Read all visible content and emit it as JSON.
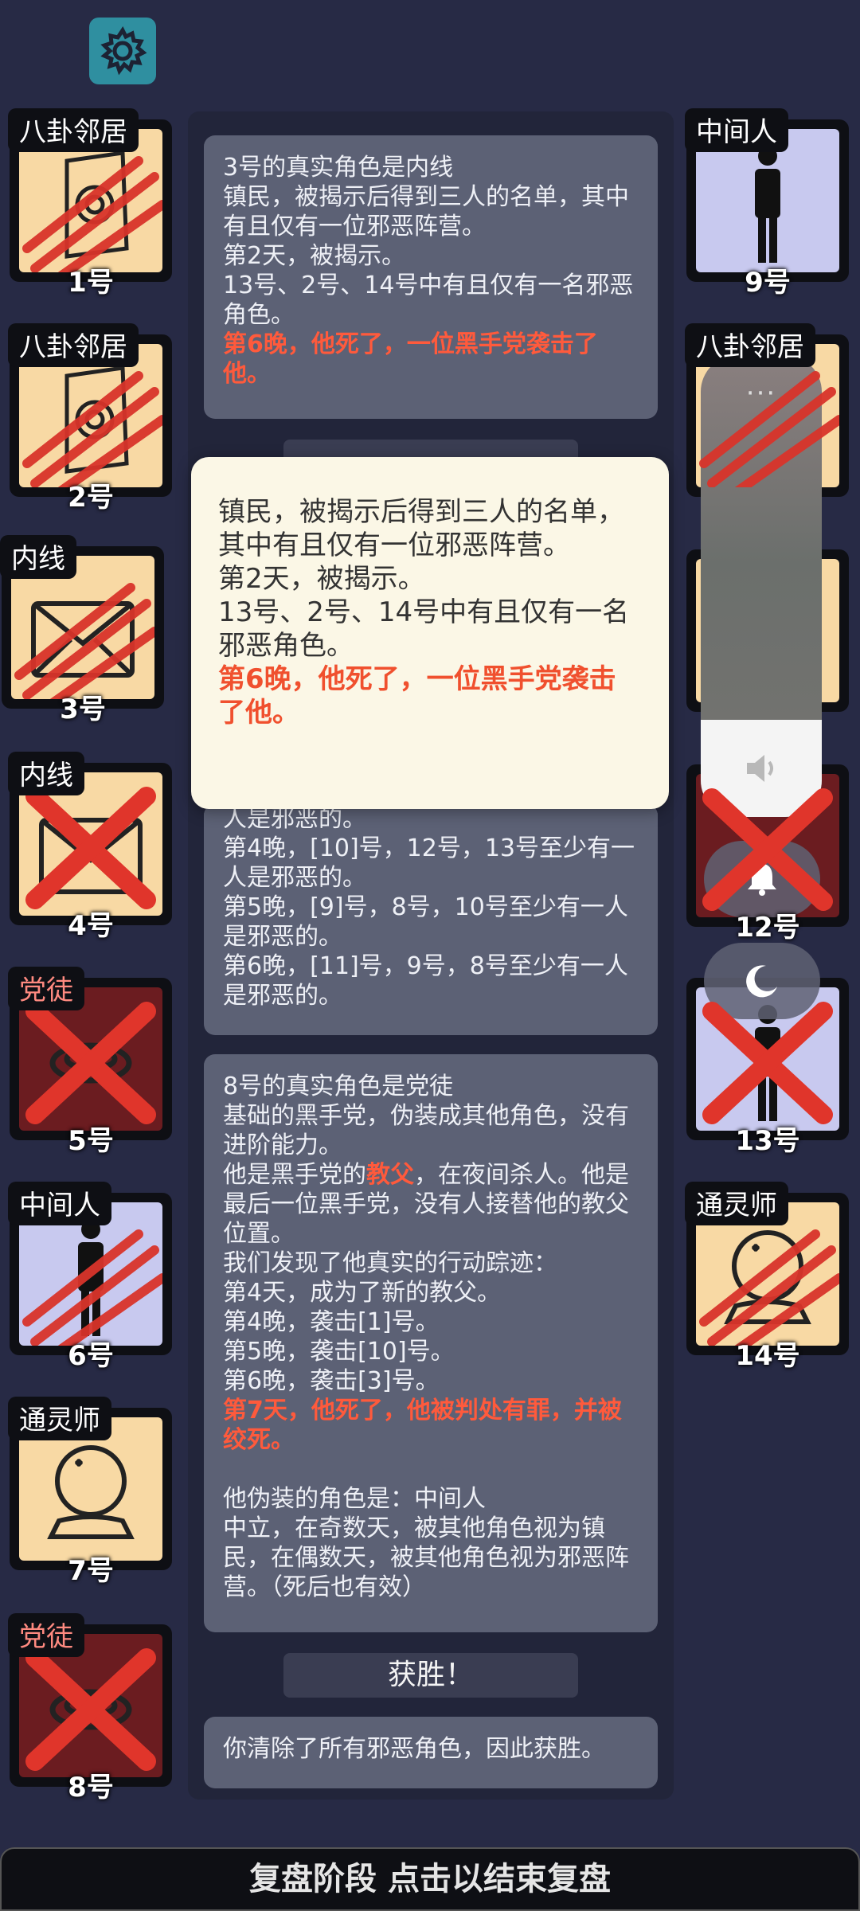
{
  "settings": {
    "icon": "gear-icon"
  },
  "players_left": [
    {
      "role": "八卦邻居",
      "num": "1号",
      "type": "town",
      "art": "gossip",
      "mark": "claw"
    },
    {
      "role": "八卦邻居",
      "num": "2号",
      "type": "town",
      "art": "gossip",
      "mark": "claw"
    },
    {
      "role": "内线",
      "num": "3号",
      "type": "town",
      "art": "envelope",
      "mark": "claw"
    },
    {
      "role": "内线",
      "num": "4号",
      "type": "town",
      "art": "envelope",
      "mark": "cross"
    },
    {
      "role": "党徒",
      "num": "5号",
      "type": "evil",
      "art": "ring",
      "mark": "cross"
    },
    {
      "role": "中间人",
      "num": "6号",
      "type": "neutral",
      "art": "person",
      "mark": "claw"
    },
    {
      "role": "通灵师",
      "num": "7号",
      "type": "town",
      "art": "crystal",
      "mark": "none"
    },
    {
      "role": "党徒",
      "num": "8号",
      "type": "evil",
      "art": "ring",
      "mark": "cross"
    }
  ],
  "players_right": [
    {
      "role": "中间人",
      "num": "9号",
      "type": "neutral",
      "art": "person",
      "mark": "none"
    },
    {
      "role": "八卦邻居",
      "num": "",
      "type": "town",
      "art": "gossip",
      "mark": "claw"
    },
    {
      "role": "",
      "num": "",
      "type": "town",
      "art": "none",
      "mark": "none"
    },
    {
      "role": "",
      "num": "12号",
      "type": "evil",
      "art": "none",
      "mark": "cross"
    },
    {
      "role": "",
      "num": "13号",
      "type": "neutral",
      "art": "person",
      "mark": "cross"
    },
    {
      "role": "通灵师",
      "num": "14号",
      "type": "town",
      "art": "crystal",
      "mark": "claw"
    }
  ],
  "log": {
    "entry1": {
      "line1": "3号的真实角色是内线",
      "line2": "镇民，被揭示后得到三人的名单，其中有且仅有一位邪恶阵营。",
      "line3": "第2天，被揭示。",
      "line4": "13号、2号、14号中有且仅有一名邪恶角色。",
      "death": "第6晚，他死了，一位黑手党袭击了他。"
    },
    "entry2": {
      "line1": "人是邪恶的。",
      "line2": "第4晚，[10]号，12号，13号至少有一人是邪恶的。",
      "line3": "第5晚，[9]号，8号，10号至少有一人是邪恶的。",
      "line4": "第6晚，[11]号，9号，8号至少有一人是邪恶的。"
    },
    "entry3": {
      "line1": "8号的真实角色是党徒",
      "line2": "基础的黑手党，伪装成其他角色，没有进阶能力。",
      "line3_a": "他是黑手党的",
      "line3_hl": "教父",
      "line3_b": "，在夜间杀人。他是最后一位黑手党，没有人接替他的教父位置。",
      "line4": "我们发现了他真实的行动踪迹：",
      "line5": "第4天，成为了新的教父。",
      "line6": "第4晚，袭击[1]号。",
      "line7": "第5晚，袭击[10]号。",
      "line8": "第6晚，袭击[3]号。",
      "death": "第7天，他死了，他被判处有罪，并被绞死。",
      "line9": "他伪装的角色是：中间人",
      "line10": "中立，在奇数天，被其他角色视为镇民，在偶数天，被其他角色视为邪恶阵营。（死后也有效）"
    },
    "win_title": "获胜！",
    "win_text": "你清除了所有邪恶角色，因此获胜。"
  },
  "popup": {
    "line1": "镇民，被揭示后得到三人的名单，其中有且仅有一位邪恶阵营。",
    "line2": "第2天，被揭示。",
    "line3": "13号、2号、14号中有且仅有一名邪恶角色。",
    "death": "第6晚，他死了，一位黑手党袭击了他。"
  },
  "system": {
    "menu_dots": "···",
    "volume_icon": "speaker-icon",
    "bell_icon": "bell-icon",
    "moon_icon": "moon-icon"
  },
  "bottom_bar": {
    "text": "复盘阶段 点击以结束复盘"
  },
  "colors": {
    "background": "#272a45",
    "town": "#f8d9a4",
    "neutral": "#c8c9ef",
    "evil": "#6b1c20",
    "death_red": "#ff5a3c",
    "mark_red": "#e0352b"
  }
}
